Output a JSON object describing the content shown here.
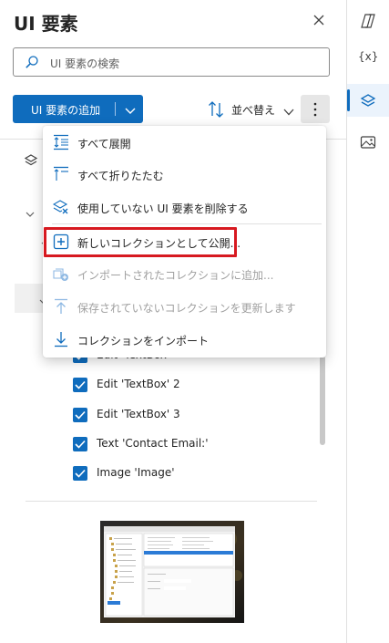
{
  "panel": {
    "title": "UI 要素",
    "search_placeholder": "UI 要素の検索",
    "add_button_label": "UI 要素の追加",
    "sort_label": "並べ替え"
  },
  "menu": {
    "items": [
      {
        "label": "すべて展開",
        "icon": "expand-all-icon",
        "enabled": true
      },
      {
        "label": "すべて折りたたむ",
        "icon": "collapse-all-icon",
        "enabled": true
      },
      {
        "label": "使用していない UI 要素を削除する",
        "icon": "remove-unused-icon",
        "enabled": true
      },
      {
        "label": "新しいコレクションとして公開...",
        "icon": "add-box-icon",
        "enabled": true,
        "highlighted": true
      },
      {
        "label": "インポートされたコレクションに追加...",
        "icon": "add-to-collection-icon",
        "enabled": false
      },
      {
        "label": "保存されていないコレクションを更新します",
        "icon": "upload-icon",
        "enabled": false
      },
      {
        "label": "コレクションをインポート",
        "icon": "download-icon",
        "enabled": true
      }
    ]
  },
  "tree": {
    "items": [
      {
        "label": "Edit 'TextBox'",
        "checked": true
      },
      {
        "label": "Edit 'TextBox' 2",
        "checked": true
      },
      {
        "label": "Edit 'TextBox' 3",
        "checked": true
      },
      {
        "label": "Text 'Contact Email:'",
        "checked": true
      },
      {
        "label": "Image 'Image'",
        "checked": true
      }
    ]
  },
  "rail": {
    "variables_label": "{x}",
    "active_index": 2
  },
  "colors": {
    "accent": "#0f6cbd",
    "highlight_border": "#d71920",
    "disabled_text": "#a0a0a0"
  }
}
